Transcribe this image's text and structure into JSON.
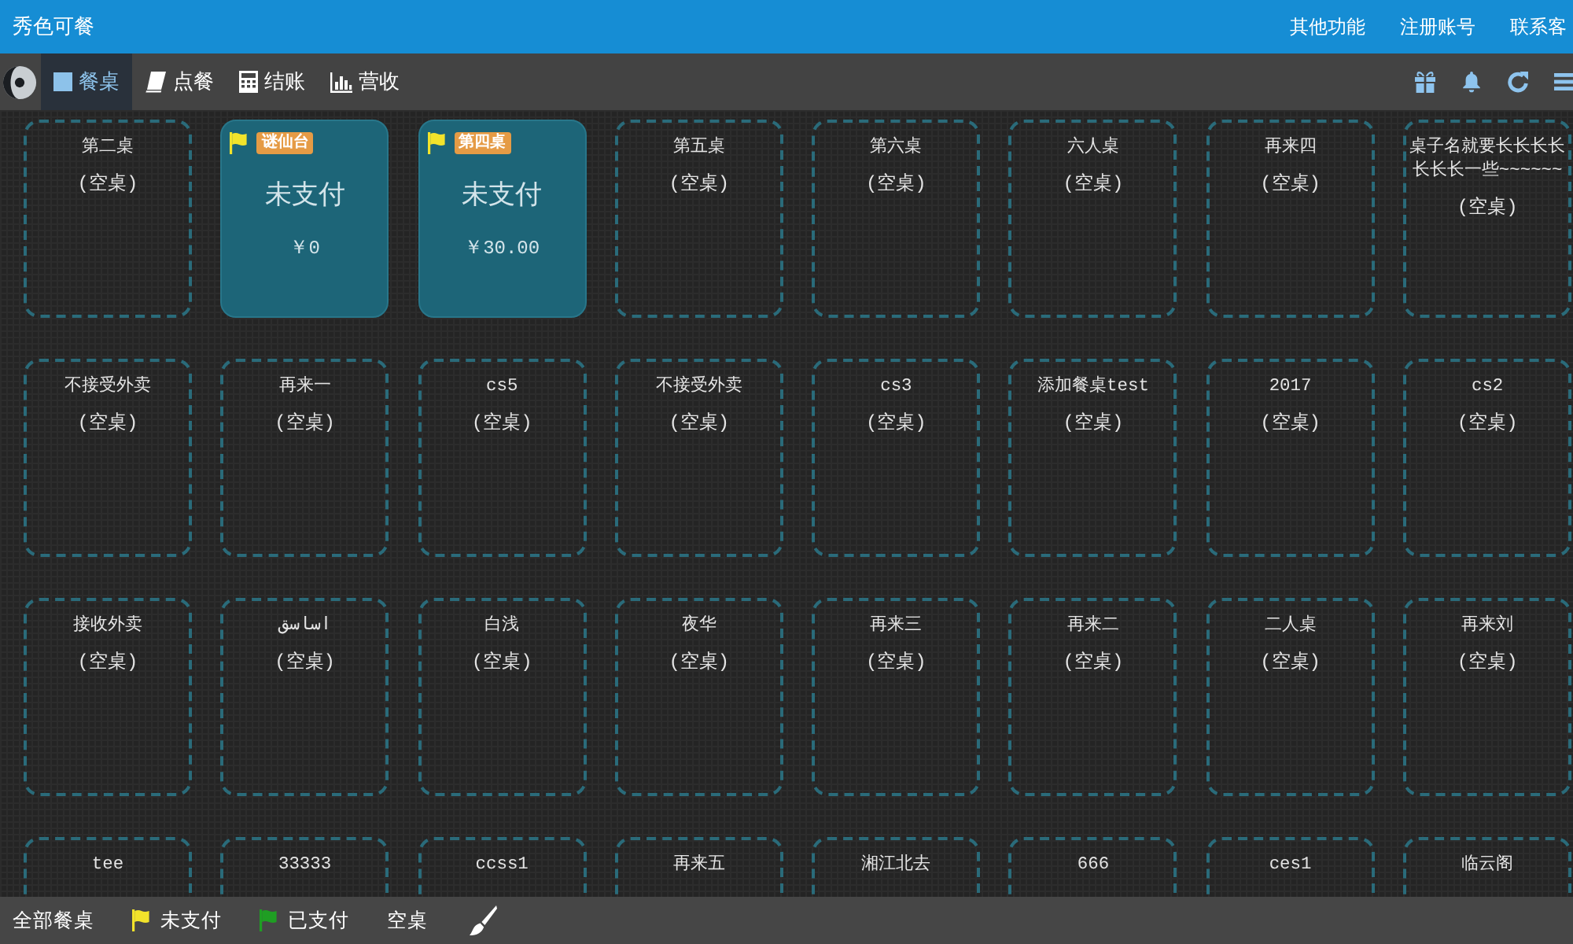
{
  "header": {
    "title": "秀色可餐",
    "links": [
      "其他功能",
      "注册账号",
      "联系客"
    ]
  },
  "toolbar": {
    "tabs": [
      {
        "label": "餐桌",
        "kind": "tables",
        "selected": true
      },
      {
        "label": "点餐",
        "kind": "order",
        "selected": false
      },
      {
        "label": "结账",
        "kind": "checkout",
        "selected": false
      },
      {
        "label": "营收",
        "kind": "revenue",
        "selected": false
      }
    ]
  },
  "tables": [
    {
      "kind": "empty",
      "name": "第二桌",
      "status": "(空桌)"
    },
    {
      "kind": "unpaid",
      "name": "谜仙台",
      "status": "未支付",
      "amount": "￥0"
    },
    {
      "kind": "unpaid",
      "name": "第四桌",
      "status": "未支付",
      "amount": "￥30.00"
    },
    {
      "kind": "empty",
      "name": "第五桌",
      "status": "(空桌)"
    },
    {
      "kind": "empty",
      "name": "第六桌",
      "status": "(空桌)"
    },
    {
      "kind": "empty",
      "name": "六人桌",
      "status": "(空桌)"
    },
    {
      "kind": "empty",
      "name": "再来四",
      "status": "(空桌)"
    },
    {
      "kind": "empty",
      "name": "桌子名就要长长长长长长长一些~~~~~~",
      "status": "(空桌)"
    },
    {
      "kind": "empty",
      "name": "不接受外卖",
      "status": "(空桌)"
    },
    {
      "kind": "empty",
      "name": "再来一",
      "status": "(空桌)"
    },
    {
      "kind": "empty",
      "name": "cs5",
      "status": "(空桌)"
    },
    {
      "kind": "empty",
      "name": "不接受外卖",
      "status": "(空桌)"
    },
    {
      "kind": "empty",
      "name": "cs3",
      "status": "(空桌)"
    },
    {
      "kind": "empty",
      "name": "添加餐桌test",
      "status": "(空桌)"
    },
    {
      "kind": "empty",
      "name": "2017",
      "status": "(空桌)"
    },
    {
      "kind": "empty",
      "name": "cs2",
      "status": "(空桌)"
    },
    {
      "kind": "empty",
      "name": "接收外卖",
      "status": "(空桌)"
    },
    {
      "kind": "empty",
      "name": "اساسق",
      "status": "(空桌)"
    },
    {
      "kind": "empty",
      "name": "白浅",
      "status": "(空桌)"
    },
    {
      "kind": "empty",
      "name": "夜华",
      "status": "(空桌)"
    },
    {
      "kind": "empty",
      "name": "再来三",
      "status": "(空桌)"
    },
    {
      "kind": "empty",
      "name": "再来二",
      "status": "(空桌)"
    },
    {
      "kind": "empty",
      "name": "二人桌",
      "status": "(空桌)"
    },
    {
      "kind": "empty",
      "name": "再来刘",
      "status": "(空桌)"
    },
    {
      "kind": "empty",
      "name": "tee"
    },
    {
      "kind": "empty",
      "name": "33333"
    },
    {
      "kind": "empty",
      "name": "ccss1"
    },
    {
      "kind": "empty",
      "name": "再来五"
    },
    {
      "kind": "empty",
      "name": "湘江北去"
    },
    {
      "kind": "empty",
      "name": "666"
    },
    {
      "kind": "empty",
      "name": "ces1"
    },
    {
      "kind": "empty",
      "name": "临云阁"
    }
  ],
  "legend": [
    {
      "label": "全部餐桌",
      "kind": "all"
    },
    {
      "label": "未支付",
      "kind": "flag",
      "color": "#f2e32b"
    },
    {
      "label": "已支付",
      "kind": "flag",
      "color": "#1f9e23"
    },
    {
      "label": "空桌",
      "kind": "plain"
    }
  ]
}
